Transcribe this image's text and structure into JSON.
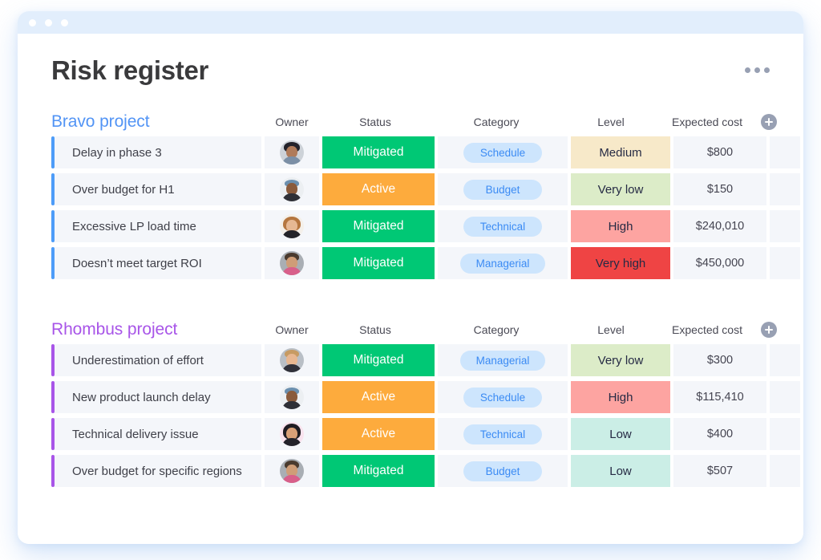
{
  "window": {
    "dots": [
      "dot-1",
      "dot-2",
      "dot-3"
    ]
  },
  "header": {
    "title": "Risk register",
    "menu_icon": "kebab-menu-icon"
  },
  "columns": {
    "owner": "Owner",
    "status": "Status",
    "category": "Category",
    "level": "Level",
    "cost": "Expected cost",
    "add_icon": "plus-circle-icon"
  },
  "colors": {
    "accent_blue": "#4d9cf8",
    "accent_purple": "#a855e8",
    "status_mitigated": "#00c875",
    "status_active": "#fdab3d",
    "level_medium": "#f7e9c9",
    "level_very_low": "#dcecc8",
    "level_high": "#fda4a1",
    "level_very_high": "#ef4444",
    "level_low": "#cbeee6",
    "pill_bg": "#cde5fd",
    "pill_text": "#3b8bf4",
    "titlebar": "#e2eefc",
    "cell_bg": "#f4f6fa"
  },
  "groups": [
    {
      "title": "Bravo project",
      "rows": [
        {
          "title": "Delay in phase 3",
          "status": "Mitigated",
          "category": "Schedule",
          "level": "Medium",
          "cost": "$800"
        },
        {
          "title": "Over budget for H1",
          "status": "Active",
          "category": "Budget",
          "level": "Very low",
          "cost": "$150"
        },
        {
          "title": "Excessive LP load time",
          "status": "Mitigated",
          "category": "Technical",
          "level": "High",
          "cost": "$240,010"
        },
        {
          "title": "Doesn’t meet target ROI",
          "status": "Mitigated",
          "category": "Managerial",
          "level": "Very high",
          "cost": "$450,000"
        }
      ]
    },
    {
      "title": "Rhombus project",
      "rows": [
        {
          "title": "Underestimation of effort",
          "status": "Mitigated",
          "category": "Managerial",
          "level": "Very low",
          "cost": "$300"
        },
        {
          "title": "New product launch delay",
          "status": "Active",
          "category": "Schedule",
          "level": "High",
          "cost": "$115,410"
        },
        {
          "title": "Technical delivery issue",
          "status": "Active",
          "category": "Technical",
          "level": "Low",
          "cost": "$400"
        },
        {
          "title": "Over budget for specific regions",
          "status": "Mitigated",
          "category": "Budget",
          "level": "Low",
          "cost": "$507"
        }
      ]
    }
  ]
}
